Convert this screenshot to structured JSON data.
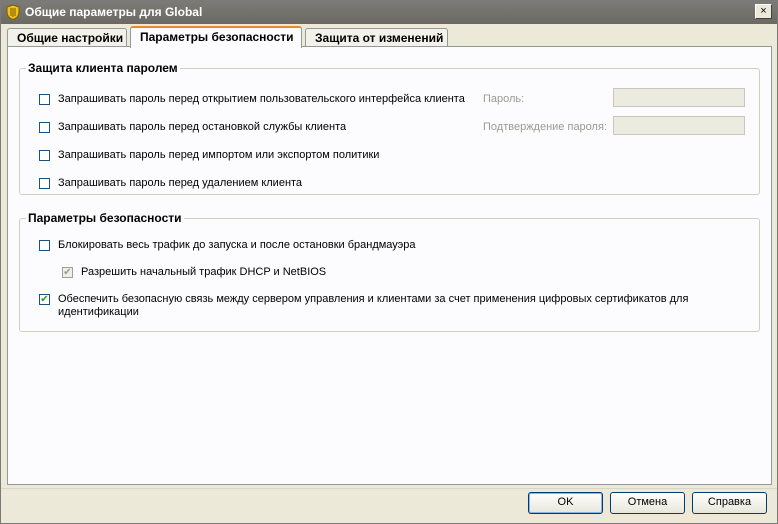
{
  "window": {
    "title": "Общие параметры для Global",
    "close_glyph": "×"
  },
  "tabs": [
    {
      "label": "Общие настройки"
    },
    {
      "label": "Параметры безопасности"
    },
    {
      "label": "Защита от изменений"
    }
  ],
  "password_group": {
    "title": "Защита клиента паролем",
    "options": [
      {
        "label": "Запрашивать пароль перед открытием пользовательского интерфейса клиента",
        "checked": false
      },
      {
        "label": "Запрашивать пароль перед остановкой службы клиента",
        "checked": false
      },
      {
        "label": "Запрашивать пароль перед импортом или экспортом политики",
        "checked": false
      },
      {
        "label": "Запрашивать пароль перед удалением клиента",
        "checked": false
      }
    ],
    "password_label": "Пароль:",
    "password_value": "",
    "confirm_label": "Подтверждение пароля:",
    "confirm_value": ""
  },
  "security_group": {
    "title": "Параметры безопасности",
    "block_traffic": {
      "label": "Блокировать весь трафик до запуска и после остановки брандмауэра",
      "checked": false
    },
    "allow_dhcp": {
      "label": "Разрешить начальный трафик DHCP и NetBIOS",
      "checked": true,
      "enabled": false
    },
    "secure_comm": {
      "label_line1": "Обеспечить безопасную связь между сервером управления и клиентами за счет применения цифровых сертификатов для",
      "label_line2": "идентификации",
      "checked": true
    }
  },
  "buttons": {
    "ok": "OK",
    "cancel": "Отмена",
    "help": "Справка"
  },
  "check_glyph": "✔"
}
